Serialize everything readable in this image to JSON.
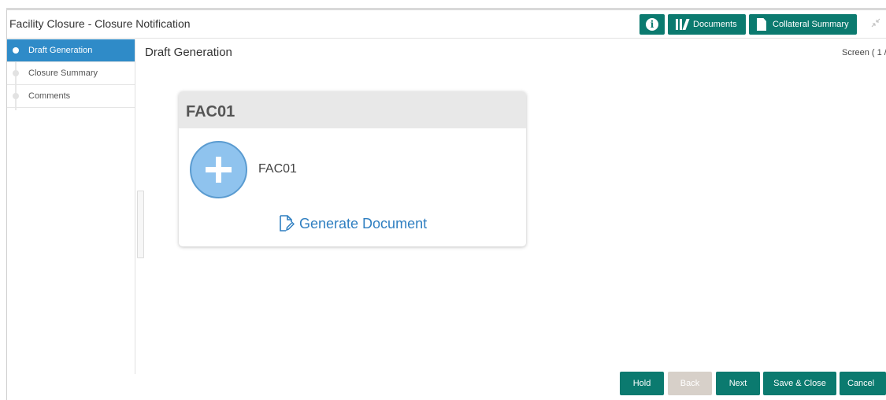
{
  "window": {
    "title": "Facility Closure - Closure Notification"
  },
  "toolbar": {
    "info_icon": "info-icon",
    "documents_label": "Documents",
    "collateral_summary_label": "Collateral Summary"
  },
  "sidebar": {
    "items": [
      {
        "label": "Draft Generation",
        "active": true
      },
      {
        "label": "Closure Summary",
        "active": false
      },
      {
        "label": "Comments",
        "active": false
      }
    ]
  },
  "main": {
    "title": "Draft Generation",
    "screen_indicator": "Screen ( 1 /",
    "card": {
      "header": "FAC01",
      "document_name": "FAC01",
      "generate_label": "Generate Document"
    }
  },
  "footer": {
    "hold": "Hold",
    "back": "Back",
    "next": "Next",
    "save_close": "Save & Close",
    "cancel": "Cancel"
  },
  "colors": {
    "accent": "#0b7a6f",
    "active_step": "#2f8bc8",
    "link": "#2f7fc1",
    "disabled": "#d7d0c9"
  }
}
